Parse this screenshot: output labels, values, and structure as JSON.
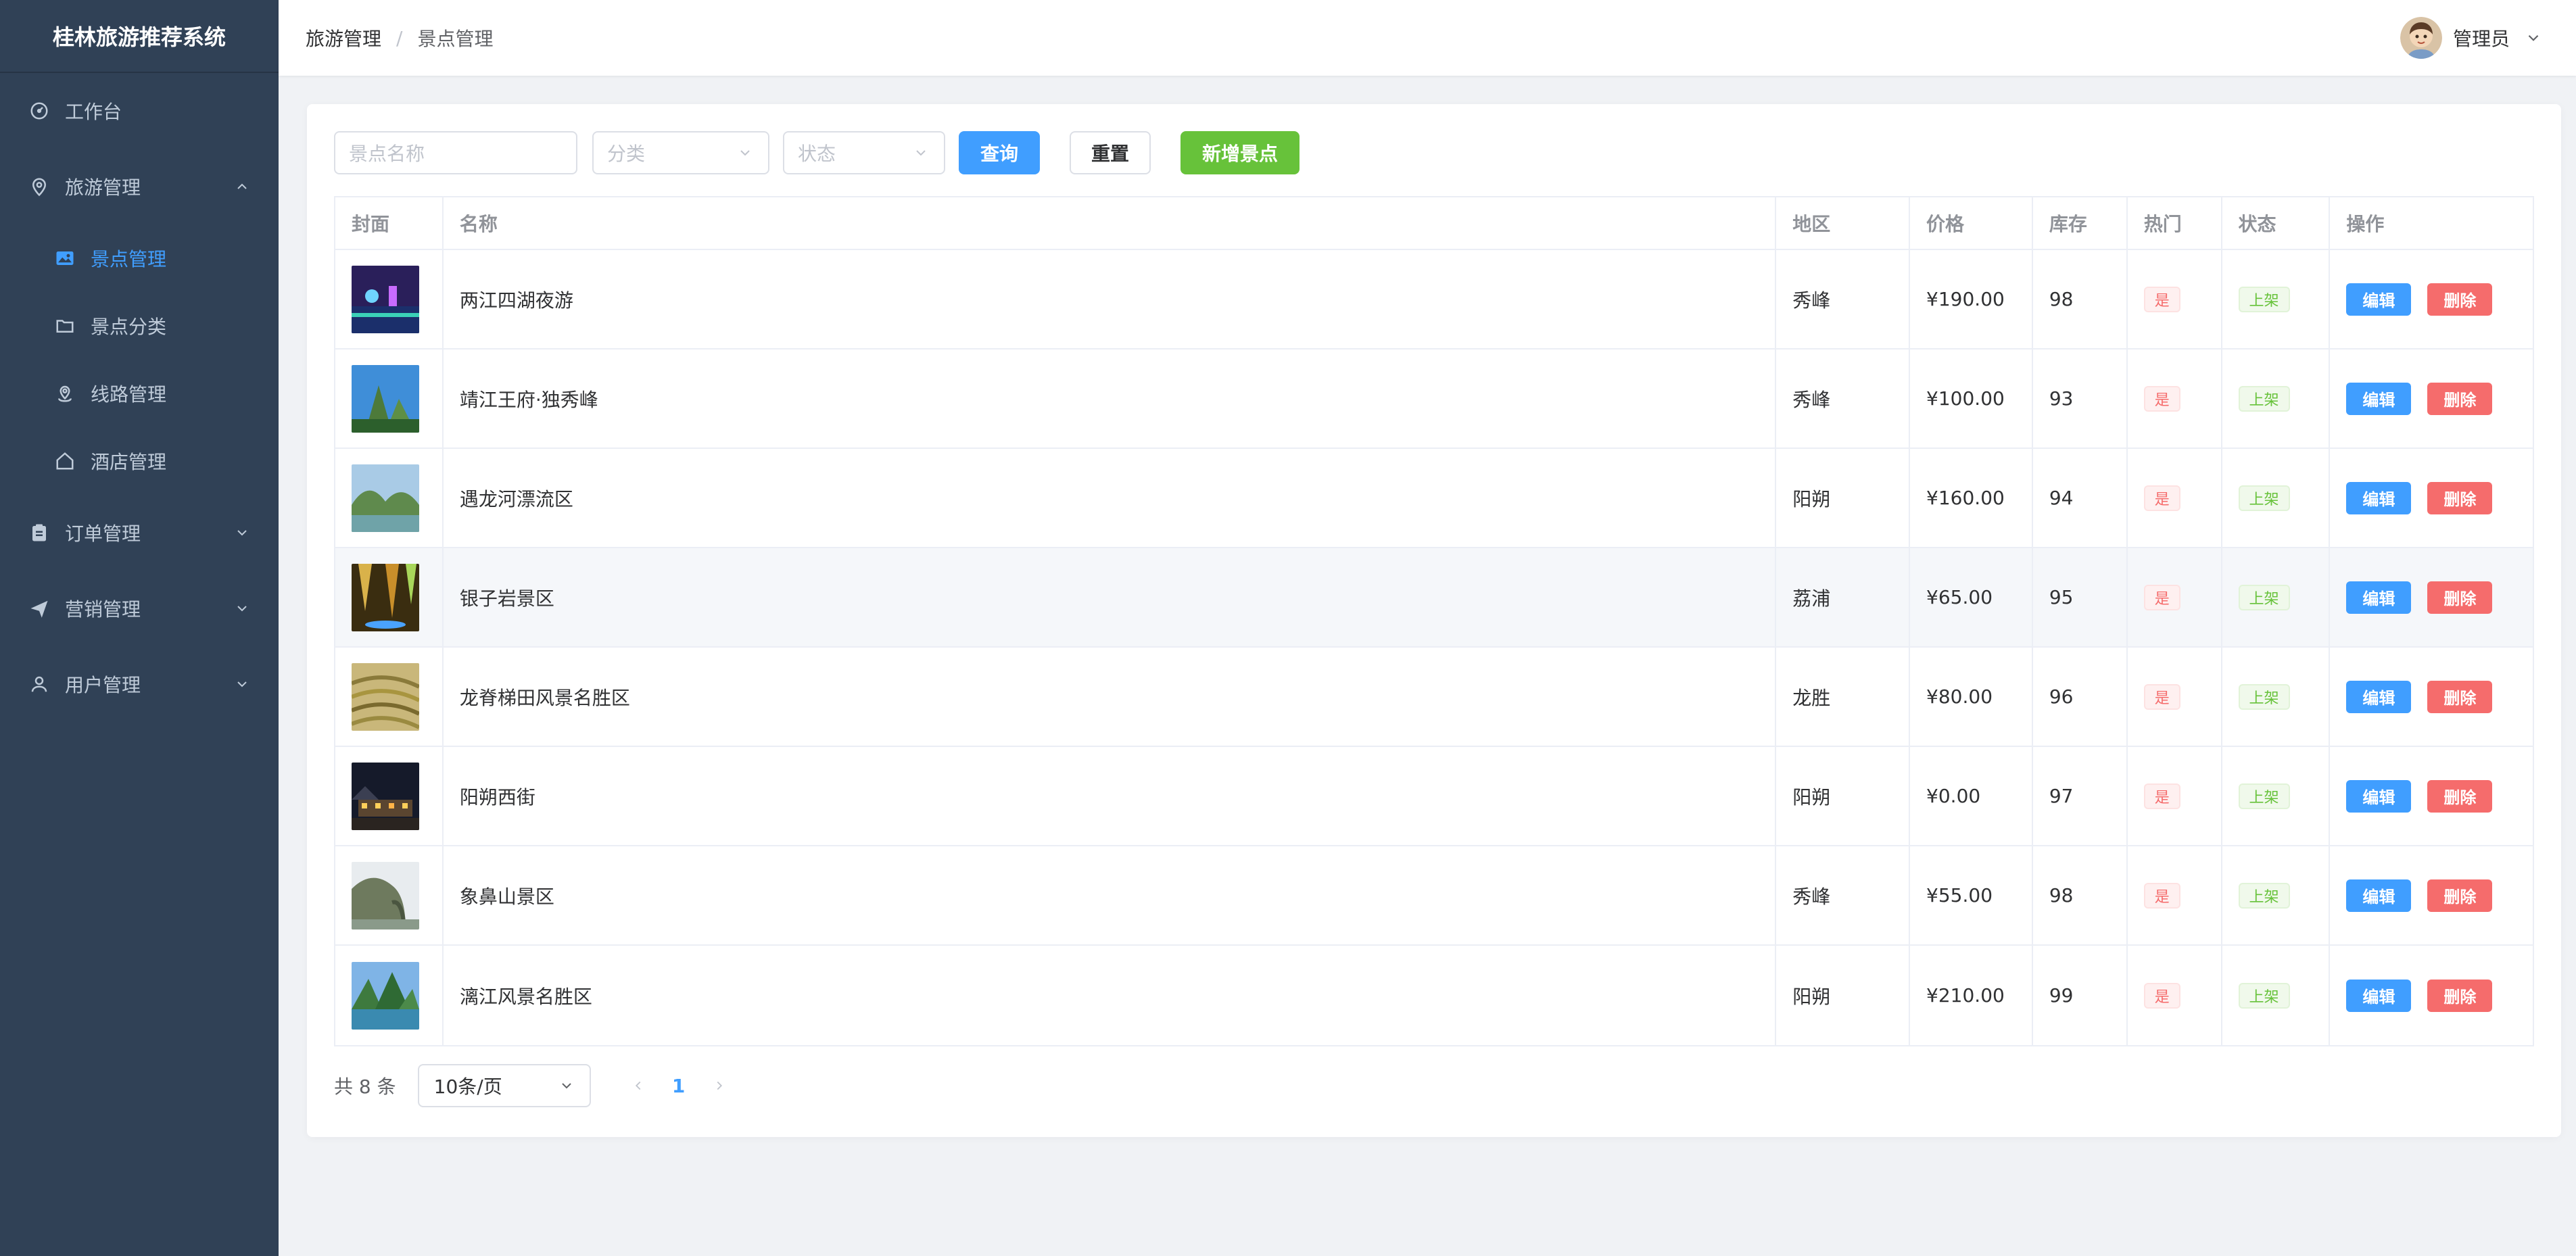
{
  "app": {
    "title": "桂林旅游推荐系统"
  },
  "sidebar": {
    "items": [
      {
        "label": "工作台",
        "icon": "dashboard-icon"
      },
      {
        "label": "旅游管理",
        "icon": "location-icon",
        "expanded": true,
        "children": [
          {
            "label": "景点管理",
            "icon": "picture-icon",
            "active": true
          },
          {
            "label": "景点分类",
            "icon": "folder-icon"
          },
          {
            "label": "线路管理",
            "icon": "route-icon"
          },
          {
            "label": "酒店管理",
            "icon": "home-icon"
          }
        ]
      },
      {
        "label": "订单管理",
        "icon": "clipboard-icon"
      },
      {
        "label": "营销管理",
        "icon": "send-icon"
      },
      {
        "label": "用户管理",
        "icon": "user-icon"
      }
    ]
  },
  "header": {
    "breadcrumb": [
      "旅游管理",
      "景点管理"
    ],
    "separator": "/",
    "user_name": "管理员"
  },
  "filters": {
    "name_placeholder": "景点名称",
    "category_placeholder": "分类",
    "status_placeholder": "状态",
    "query_label": "查询",
    "reset_label": "重置",
    "add_label": "新增景点"
  },
  "table": {
    "headers": [
      "封面",
      "名称",
      "地区",
      "价格",
      "库存",
      "热门",
      "状态",
      "操作"
    ],
    "rows": [
      {
        "name": "两江四湖夜游",
        "region": "秀峰",
        "price": "¥190.00",
        "stock": "98",
        "hot": "是",
        "status": "上架"
      },
      {
        "name": "靖江王府·独秀峰",
        "region": "秀峰",
        "price": "¥100.00",
        "stock": "93",
        "hot": "是",
        "status": "上架"
      },
      {
        "name": "遇龙河漂流区",
        "region": "阳朔",
        "price": "¥160.00",
        "stock": "94",
        "hot": "是",
        "status": "上架"
      },
      {
        "name": "银子岩景区",
        "region": "荔浦",
        "price": "¥65.00",
        "stock": "95",
        "hot": "是",
        "status": "上架"
      },
      {
        "name": "龙脊梯田风景名胜区",
        "region": "龙胜",
        "price": "¥80.00",
        "stock": "96",
        "hot": "是",
        "status": "上架"
      },
      {
        "name": "阳朔西街",
        "region": "阳朔",
        "price": "¥0.00",
        "stock": "97",
        "hot": "是",
        "status": "上架"
      },
      {
        "name": "象鼻山景区",
        "region": "秀峰",
        "price": "¥55.00",
        "stock": "98",
        "hot": "是",
        "status": "上架"
      },
      {
        "name": "漓江风景名胜区",
        "region": "阳朔",
        "price": "¥210.00",
        "stock": "99",
        "hot": "是",
        "status": "上架"
      }
    ],
    "edit_label": "编辑",
    "delete_label": "删除"
  },
  "pagination": {
    "total_text": "共 8 条",
    "page_size": "10条/页",
    "current_page": "1"
  },
  "colors": {
    "sidebar_bg": "#304156",
    "primary": "#409eff",
    "success": "#67c23a",
    "danger": "#f56c6c"
  }
}
